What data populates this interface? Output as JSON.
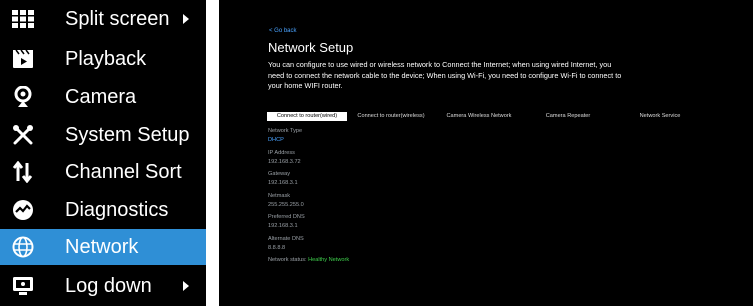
{
  "menu": {
    "items": [
      {
        "label": "Split screen",
        "icon": "grid-icon",
        "has_arrow": true,
        "active": false
      },
      {
        "label": "Playback",
        "icon": "clapperboard-icon",
        "has_arrow": false,
        "active": false
      },
      {
        "label": "Camera",
        "icon": "camera-icon",
        "has_arrow": false,
        "active": false
      },
      {
        "label": "System Setup",
        "icon": "tools-icon",
        "has_arrow": false,
        "active": false
      },
      {
        "label": "Channel Sort",
        "icon": "sort-icon",
        "has_arrow": false,
        "active": false
      },
      {
        "label": "Diagnostics",
        "icon": "diagnostics-icon",
        "has_arrow": false,
        "active": false
      },
      {
        "label": "Network",
        "icon": "globe-icon",
        "has_arrow": false,
        "active": true
      },
      {
        "label": "Log down",
        "icon": "monitor-icon",
        "has_arrow": true,
        "active": false
      }
    ],
    "active_color": "#2f8fd6"
  },
  "panel": {
    "go_back": "< Go back",
    "title": "Network Setup",
    "description": "You can configure to use wired or wireless network to Connect the Internet; when using wired Internet, you need to connect the network cable to the device; When using Wi-Fi, you need to configure Wi-Fi to connect to your home WIFI router.",
    "tabs": [
      {
        "label": "Connect to router(wired)",
        "active": true
      },
      {
        "label": "Connect to router(wireless)",
        "active": false
      },
      {
        "label": "Camera Wireless Network",
        "active": false
      },
      {
        "label": "Camera Repeater",
        "active": false
      },
      {
        "label": "Network Service",
        "active": false
      }
    ],
    "fields": {
      "network_type": {
        "label": "Network Type",
        "value": "DHCP"
      },
      "ip_address": {
        "label": "IP Address",
        "value": "192.168.3.72"
      },
      "gateway": {
        "label": "Gateway",
        "value": "192.168.3.1"
      },
      "netmask": {
        "label": "Netmask",
        "value": "255.255.255.0"
      },
      "preferred_dns": {
        "label": "Preferred DNS",
        "value": "192.168.3.1"
      },
      "alternate_dns": {
        "label": "Alternate DNS",
        "value": "8.8.8.8"
      }
    },
    "status_label": "Network status:",
    "status_value": "Healthy Network",
    "status_color": "#3fcf4c",
    "link_color": "#4aa3ff"
  }
}
